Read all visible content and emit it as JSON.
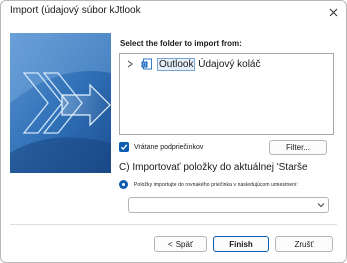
{
  "window": {
    "title": "Import (údajový súbor kJtlook"
  },
  "main": {
    "prompt": "Select the folder to import from:",
    "tree": {
      "items": [
        {
          "label_highlight": "Outlook",
          "label_rest": " Údajový koláč"
        }
      ]
    },
    "include_subfolders": {
      "label": "Vrátane podpriečinkov",
      "checked": true
    },
    "filter_button": "Filter...",
    "option_current": "C) Importovať položky do aktuálnej 'Starše",
    "option_same": {
      "label": "Položky importujte do rovnakého priečinka v nasledujúcom umiestnení:",
      "selected": true
    },
    "destination_select": {
      "value": ""
    }
  },
  "footer": {
    "back_arrow": "<",
    "back_label": "Späť",
    "finish_label": "Finish",
    "cancel_label": "Zrušť"
  },
  "colors": {
    "accent": "#0f5db0",
    "art_blue": "#2d72b9"
  }
}
